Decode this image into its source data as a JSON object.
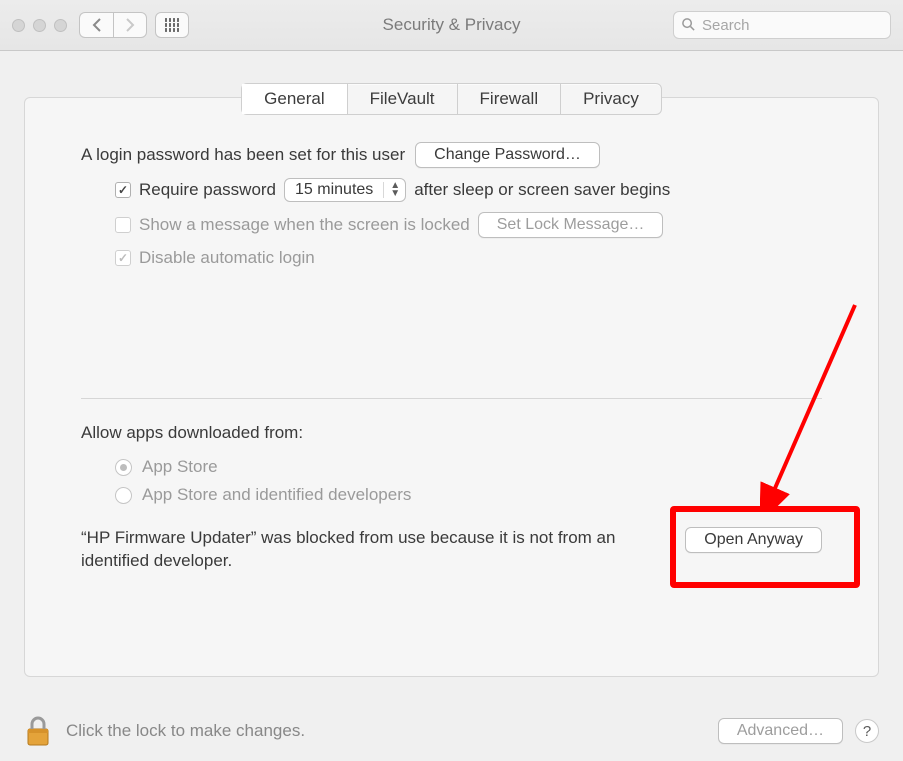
{
  "window": {
    "title": "Security & Privacy",
    "search_placeholder": "Search"
  },
  "tabs": {
    "general": "General",
    "filevault": "FileVault",
    "firewall": "Firewall",
    "privacy": "Privacy",
    "active": "general"
  },
  "login": {
    "text": "A login password has been set for this user",
    "change_password": "Change Password…",
    "require_password": "Require password",
    "require_password_delay": "15 minutes",
    "after_sleep": "after sleep or screen saver begins",
    "show_message": "Show a message when the screen is locked",
    "set_lock_message": "Set Lock Message…",
    "disable_auto_login": "Disable automatic login"
  },
  "downloads": {
    "label": "Allow apps downloaded from:",
    "app_store": "App Store",
    "identified": "App Store and identified developers",
    "blocked_message": "“HP Firmware Updater” was blocked from use because it is not from an identified developer.",
    "open_anyway": "Open Anyway"
  },
  "footer": {
    "lock_text": "Click the lock to make changes.",
    "advanced": "Advanced…",
    "help": "?"
  }
}
